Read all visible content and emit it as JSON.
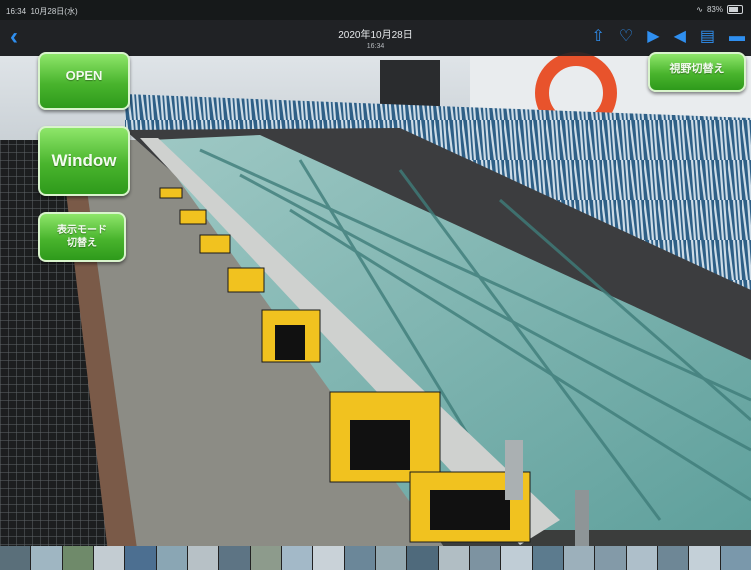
{
  "status_bar": {
    "time": "16:34",
    "date_text": "10月28日(水)",
    "battery": "83%"
  },
  "nav_bar": {
    "title": "2020年10月28日",
    "subtitle": "16:34"
  },
  "buttons": {
    "open": "OPEN",
    "window": "Window",
    "switch_line1": "表示モード",
    "switch_line2": "切替え",
    "view_switch": "視野切替え"
  },
  "icons": {
    "back": "chevron-left-icon",
    "share": "share-icon",
    "favorite": "heart-icon",
    "play": "play-icon",
    "volume": "speaker-icon",
    "trash": "trash-icon",
    "more": "more-icon"
  },
  "colors": {
    "accent": "#2f8ff0",
    "button_green": "#49b42d"
  },
  "thumbnails": [
    "#5a6f7a",
    "#9fb6c2",
    "#6f8a6a",
    "#c3ccd2",
    "#4c6f91",
    "#8aa6b4",
    "#b7c1c6",
    "#5d7484",
    "#8d9b8c",
    "#a3b9c8",
    "#c9d2d8",
    "#6b8799",
    "#93a8b0",
    "#4f6a7c",
    "#b1bec4",
    "#7d93a1",
    "#c0cdd6",
    "#5c7b8e",
    "#9cb0bb",
    "#839aa8",
    "#aebfca",
    "#6e8796",
    "#c4d0d8",
    "#7a98ab"
  ]
}
